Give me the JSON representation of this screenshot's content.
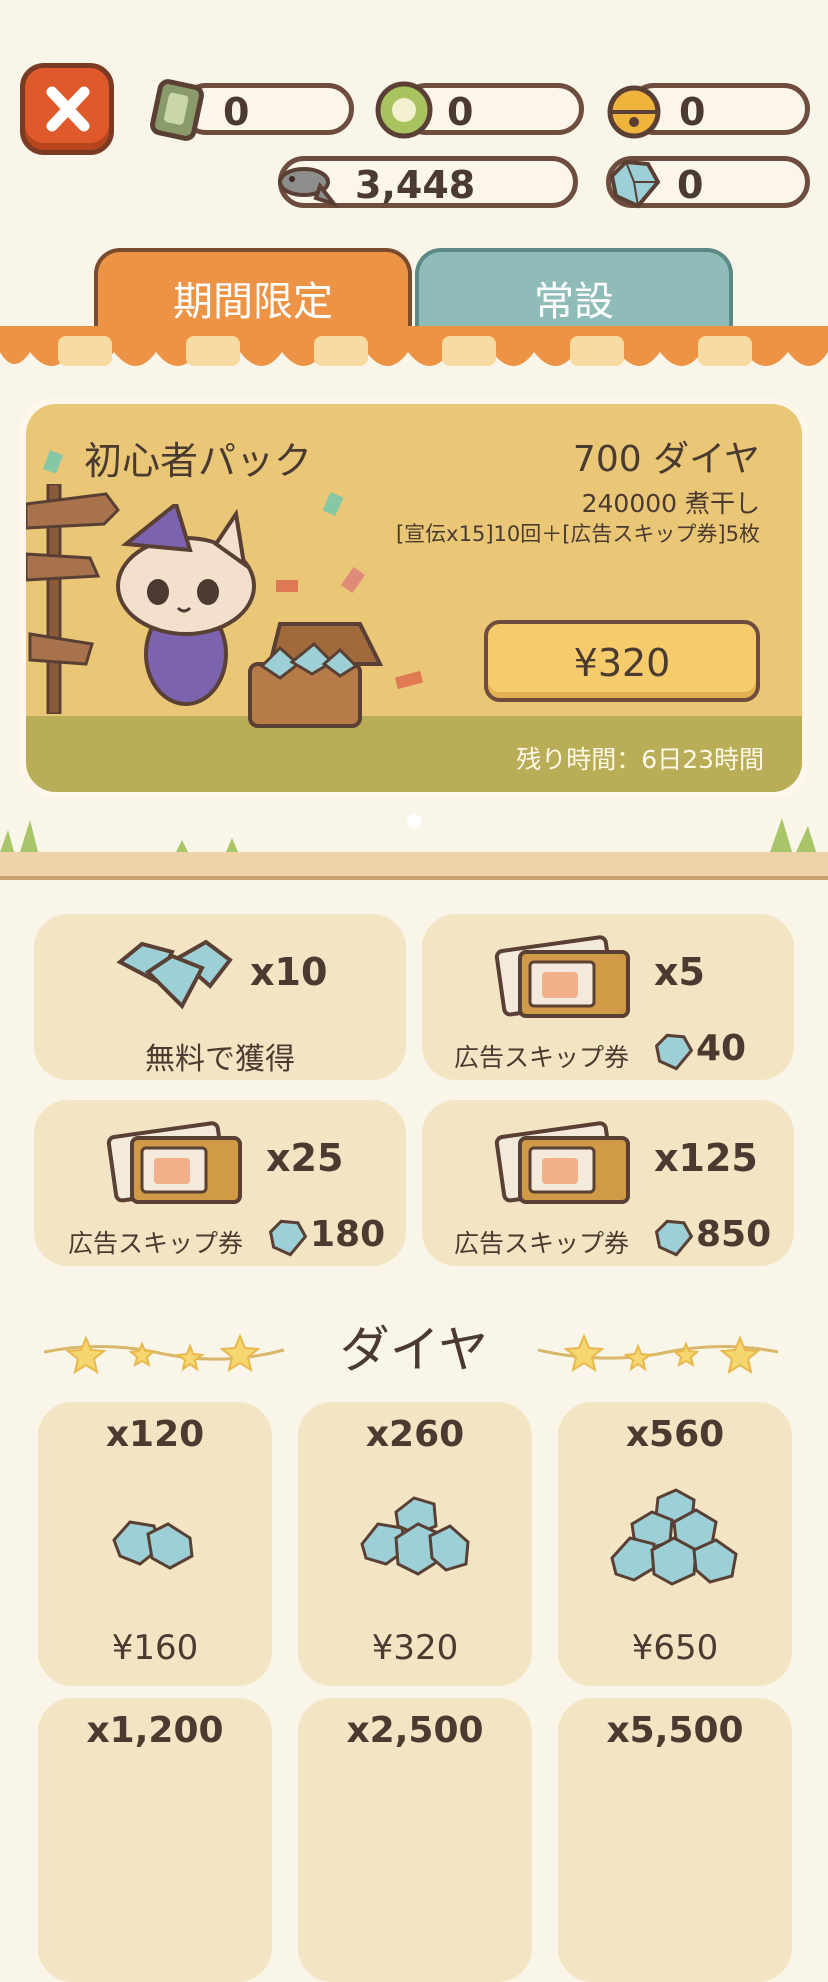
{
  "header": {
    "currencies": [
      {
        "name": "ticket",
        "value": "0"
      },
      {
        "name": "coin",
        "value": "0"
      },
      {
        "name": "bell",
        "value": "0"
      },
      {
        "name": "fish",
        "value": "3,448"
      },
      {
        "name": "diamond",
        "value": "0"
      }
    ]
  },
  "tabs": [
    {
      "label": "期間限定",
      "active": true
    },
    {
      "label": "常設",
      "active": false
    }
  ],
  "banner": {
    "title": "初心者パック",
    "diamonds": "700 ダイヤ",
    "dried_fish": "240000 煮干し",
    "extras": "[宣伝x15]10回＋[広告スキップ券]5枚",
    "price": "¥320",
    "remaining": "残り時間：6日23時間"
  },
  "items": [
    {
      "qty": "x10",
      "label": "無料で獲得",
      "cost": ""
    },
    {
      "qty": "x5",
      "label": "広告スキップ券",
      "cost": "40"
    },
    {
      "qty": "x25",
      "label": "広告スキップ券",
      "cost": "180"
    },
    {
      "qty": "x125",
      "label": "広告スキップ券",
      "cost": "850"
    }
  ],
  "diamond_section": {
    "title": "ダイヤ",
    "packs": [
      {
        "qty": "x120",
        "price": "¥160"
      },
      {
        "qty": "x260",
        "price": "¥320"
      },
      {
        "qty": "x560",
        "price": "¥650"
      },
      {
        "qty": "x1,200",
        "price": ""
      },
      {
        "qty": "x2,500",
        "price": ""
      },
      {
        "qty": "x5,500",
        "price": ""
      }
    ]
  },
  "colors": {
    "background": "#faf5e9",
    "accent_orange": "#ec9346",
    "teal_tab": "#8fbcb8",
    "card": "#f3e5c4",
    "banner": "#e9c777",
    "close_button": "#e0592b"
  }
}
